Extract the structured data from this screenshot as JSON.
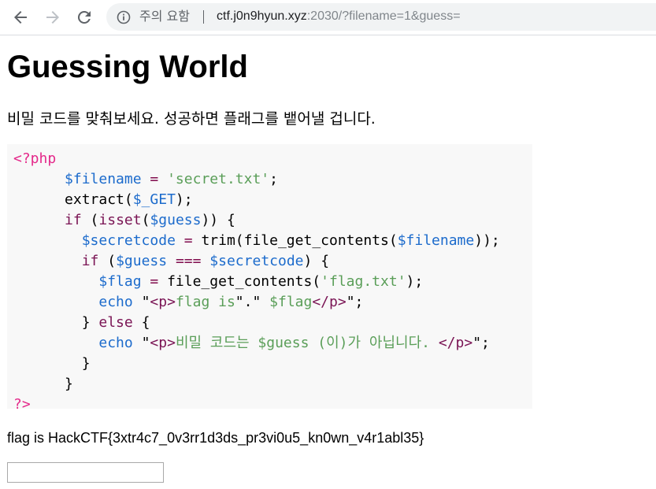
{
  "browser": {
    "back_icon": "arrow-left",
    "forward_icon": "arrow-right",
    "reload_icon": "reload",
    "security_icon": "info-circle",
    "security_label": "주의 요함",
    "url_host": "ctf.j0n9hyun.xyz",
    "url_rest": ":2030/?filename=1&guess="
  },
  "page": {
    "title": "Guessing World",
    "description": "비밀 코드를 맞춰보세요. 성공하면 플래그를 뱉어낼 겁니다.",
    "code_lines": [
      [
        {
          "t": "<?php",
          "c": "k-tag"
        }
      ],
      [
        {
          "t": "      ",
          "c": "k-plain"
        },
        {
          "t": "$filename",
          "c": "k-var"
        },
        {
          "t": " = ",
          "c": "k-op"
        },
        {
          "t": "'secret.txt'",
          "c": "k-str"
        },
        {
          "t": ";",
          "c": "k-plain"
        }
      ],
      [
        {
          "t": "      extract(",
          "c": "k-plain"
        },
        {
          "t": "$_GET",
          "c": "k-var"
        },
        {
          "t": ");",
          "c": "k-plain"
        }
      ],
      [
        {
          "t": "      ",
          "c": "k-plain"
        },
        {
          "t": "if",
          "c": "k-kw"
        },
        {
          "t": " (",
          "c": "k-plain"
        },
        {
          "t": "isset",
          "c": "k-kw"
        },
        {
          "t": "(",
          "c": "k-plain"
        },
        {
          "t": "$guess",
          "c": "k-var"
        },
        {
          "t": ")) {",
          "c": "k-plain"
        }
      ],
      [
        {
          "t": "        ",
          "c": "k-plain"
        },
        {
          "t": "$secretcode",
          "c": "k-var"
        },
        {
          "t": " = ",
          "c": "k-op"
        },
        {
          "t": "trim(file_get_contents(",
          "c": "k-plain"
        },
        {
          "t": "$filename",
          "c": "k-var"
        },
        {
          "t": "));",
          "c": "k-plain"
        }
      ],
      [
        {
          "t": "        ",
          "c": "k-plain"
        },
        {
          "t": "if",
          "c": "k-kw"
        },
        {
          "t": " (",
          "c": "k-plain"
        },
        {
          "t": "$guess",
          "c": "k-var"
        },
        {
          "t": " === ",
          "c": "k-op"
        },
        {
          "t": "$secretcode",
          "c": "k-var"
        },
        {
          "t": ") {",
          "c": "k-plain"
        }
      ],
      [
        {
          "t": "          ",
          "c": "k-plain"
        },
        {
          "t": "$flag",
          "c": "k-var"
        },
        {
          "t": " = ",
          "c": "k-op"
        },
        {
          "t": "file_get_contents(",
          "c": "k-plain"
        },
        {
          "t": "'flag.txt'",
          "c": "k-str"
        },
        {
          "t": ");",
          "c": "k-plain"
        }
      ],
      [
        {
          "t": "          ",
          "c": "k-plain"
        },
        {
          "t": "echo",
          "c": "k-var"
        },
        {
          "t": " \"",
          "c": "k-plain"
        },
        {
          "t": "<p>",
          "c": "k-kw"
        },
        {
          "t": "flag is",
          "c": "k-str"
        },
        {
          "t": "\".\" ",
          "c": "k-plain"
        },
        {
          "t": "$flag",
          "c": "k-str"
        },
        {
          "t": "</p>",
          "c": "k-kw"
        },
        {
          "t": "\";",
          "c": "k-plain"
        }
      ],
      [
        {
          "t": "        } ",
          "c": "k-plain"
        },
        {
          "t": "else",
          "c": "k-kw"
        },
        {
          "t": " {",
          "c": "k-plain"
        }
      ],
      [
        {
          "t": "          ",
          "c": "k-plain"
        },
        {
          "t": "echo",
          "c": "k-var"
        },
        {
          "t": " \"",
          "c": "k-plain"
        },
        {
          "t": "<p>",
          "c": "k-kw"
        },
        {
          "t": "비밀 코드는 ",
          "c": "k-str"
        },
        {
          "t": "$guess",
          "c": "k-str"
        },
        {
          "t": " (이)가 아닙니다. ",
          "c": "k-str"
        },
        {
          "t": "</p>",
          "c": "k-kw"
        },
        {
          "t": "\";",
          "c": "k-plain"
        }
      ],
      [
        {
          "t": "        }",
          "c": "k-plain"
        }
      ],
      [
        {
          "t": "      }",
          "c": "k-plain"
        }
      ],
      [
        {
          "t": "?>",
          "c": "k-tag"
        }
      ]
    ],
    "flag_output": "flag is HackCTF{3xtr4c7_0v3rr1d3ds_pr3vi0u5_kn0wn_v4r1abl35}",
    "guess_input_value": "",
    "guess_input_placeholder": ""
  }
}
